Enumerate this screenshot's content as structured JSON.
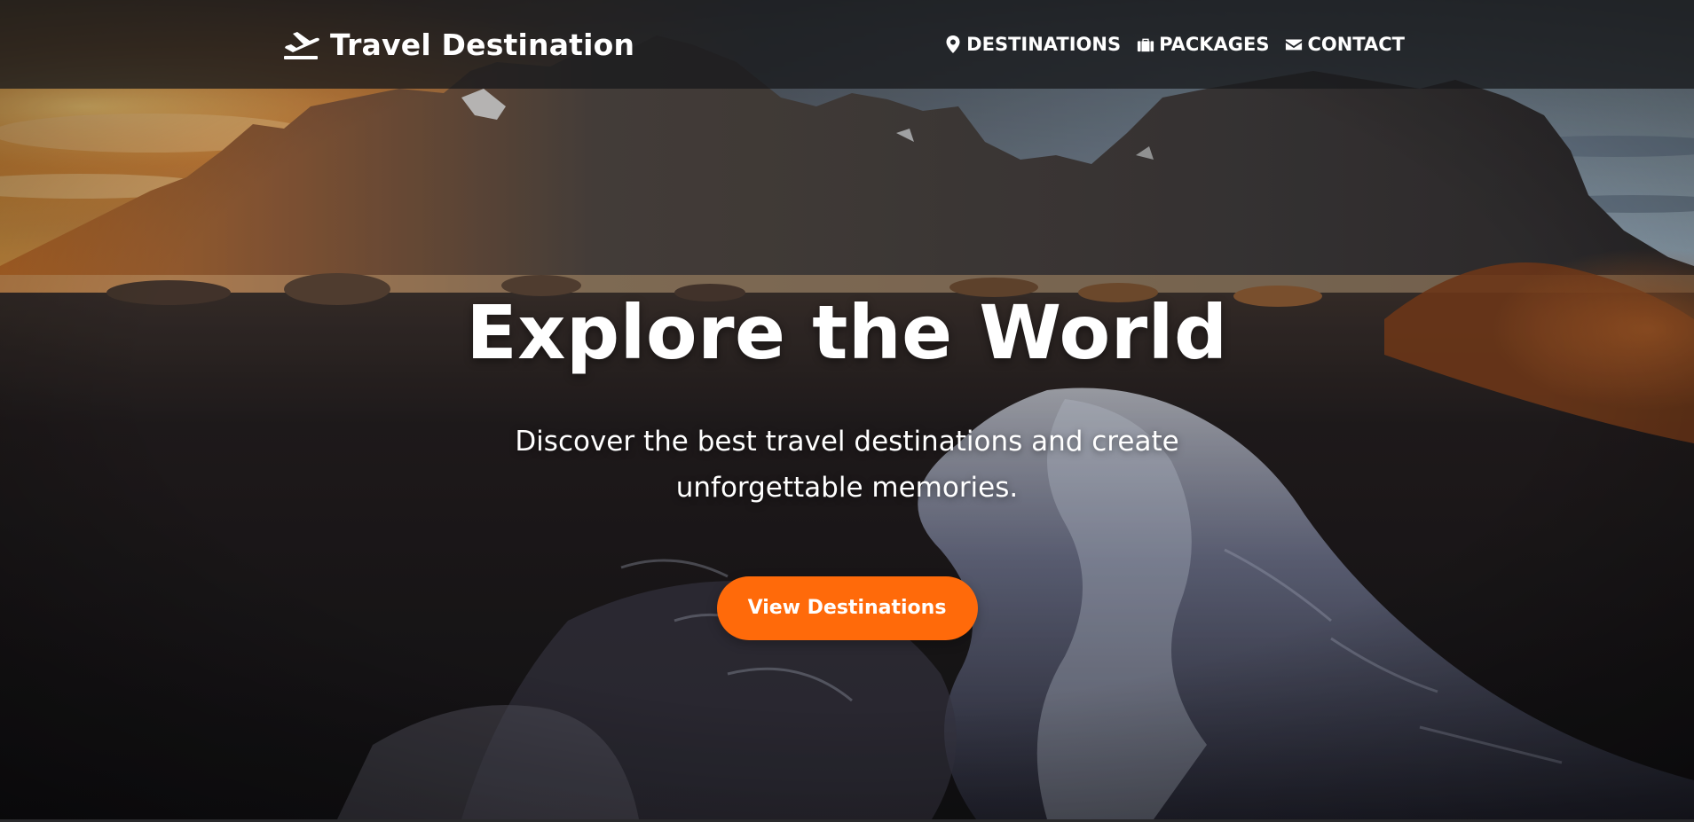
{
  "nav": {
    "brand": "Travel Destination",
    "brand_icon": "plane-departure-icon",
    "links": [
      {
        "label": "DESTINATIONS",
        "icon": "map-marker-icon"
      },
      {
        "label": "PACKAGES",
        "icon": "suitcase-icon"
      },
      {
        "label": "CONTACT",
        "icon": "envelope-icon"
      }
    ]
  },
  "hero": {
    "title": "Explore the World",
    "subtitle": "Discover the best travel destinations and create unforgettable memories.",
    "cta_label": "View Destinations"
  },
  "colors": {
    "accent": "#ff6a0a",
    "navbar_bg": "#181a1c",
    "text": "#ffffff"
  }
}
